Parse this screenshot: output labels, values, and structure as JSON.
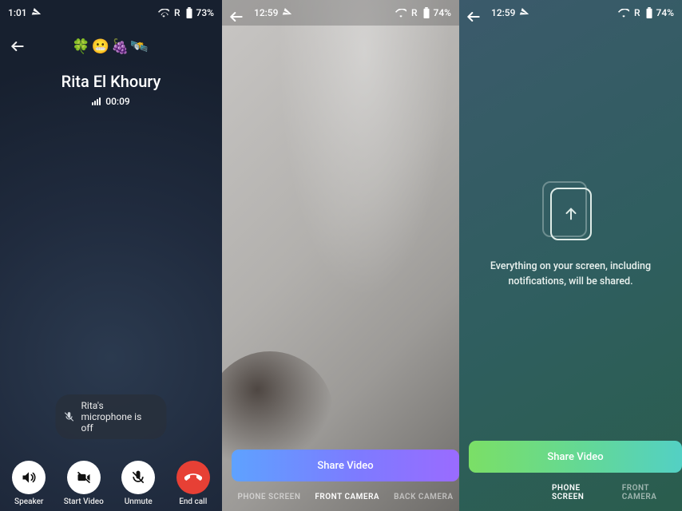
{
  "screen1": {
    "status": {
      "time": "1:01",
      "signal": "R",
      "battery": "73%"
    },
    "emoji_strip": "🍀😬🍇🛰️",
    "caller_name": "Rita El Khoury",
    "call_duration": "00:09",
    "mic_notice": "Rita's microphone is off",
    "buttons": {
      "speaker": "Speaker",
      "start_video": "Start Video",
      "unmute": "Unmute",
      "end_call": "End call"
    }
  },
  "screen2": {
    "status": {
      "time": "12:59",
      "signal": "R",
      "battery": "74%"
    },
    "share_button": "Share Video",
    "tabs": {
      "phone_screen": "PHONE SCREEN",
      "front_camera": "FRONT CAMERA",
      "back_camera": "BACK CAMERA"
    },
    "active_tab": "front_camera"
  },
  "screen3": {
    "status": {
      "time": "12:59",
      "signal": "R",
      "battery": "74%"
    },
    "info_text": "Everything on your screen, including notifications, will be shared.",
    "share_button": "Share Video",
    "tabs": {
      "phone_screen": "PHONE SCREEN",
      "front_camera": "FRONT CAMERA"
    },
    "active_tab": "phone_screen"
  }
}
